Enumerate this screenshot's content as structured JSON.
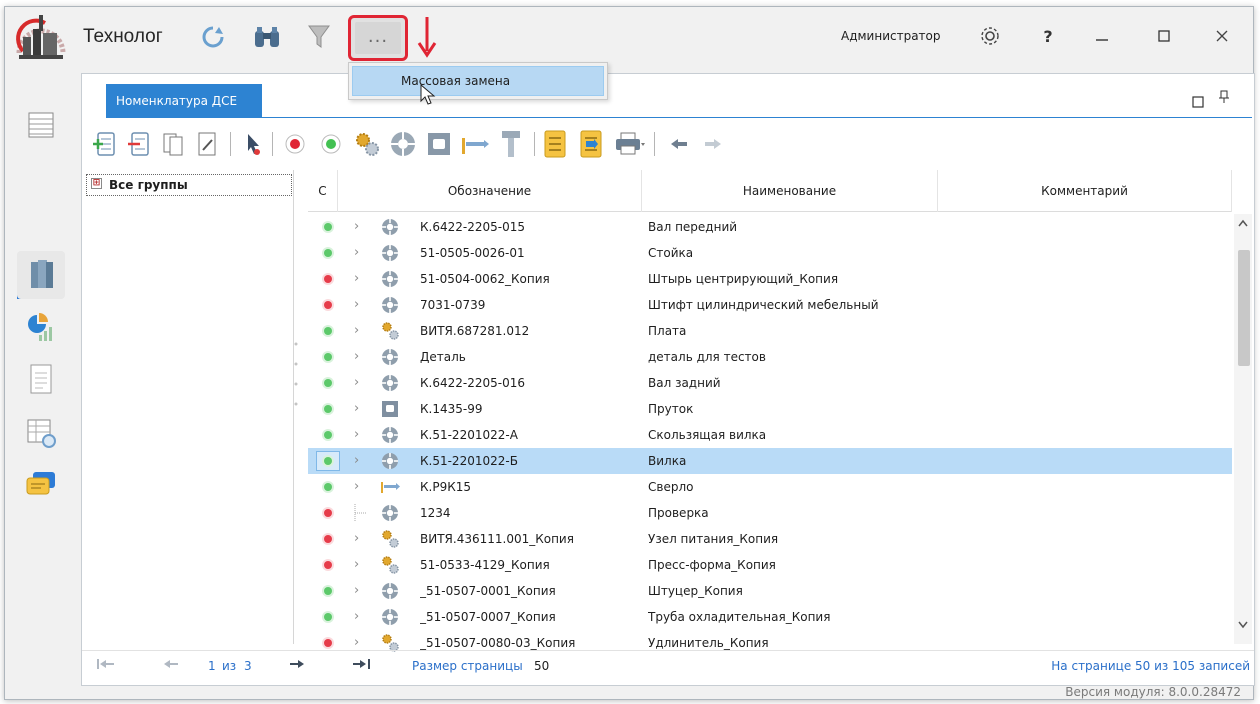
{
  "window": {
    "title": "Технолог",
    "user": "Администратор",
    "more_label": "...",
    "help_label": "?",
    "version": "Версия модуля: 8.0.0.28472"
  },
  "menu": {
    "items": [
      {
        "label": "Массовая замена"
      }
    ]
  },
  "tab": {
    "label": "Номенклатура ДСЕ"
  },
  "tree": {
    "root_label": "Все группы",
    "expander": "⊞"
  },
  "grid": {
    "columns": {
      "status": "С",
      "designation": "Обозначение",
      "name": "Наименование",
      "comment": "Комментарий"
    },
    "rows": [
      {
        "status": "green",
        "type": "part",
        "designation": "К.6422-2205-015",
        "name": "Вал передний",
        "comment": ""
      },
      {
        "status": "green",
        "type": "part",
        "designation": "51-0505-0026-01",
        "name": "Стойка",
        "comment": ""
      },
      {
        "status": "red",
        "type": "part",
        "designation": "51-0504-0062_Копия",
        "name": "Штырь центрирующий_Копия",
        "comment": ""
      },
      {
        "status": "red",
        "type": "part",
        "designation": "7031-0739",
        "name": "Штифт цилиндрический мебельный",
        "comment": ""
      },
      {
        "status": "green",
        "type": "assembly",
        "designation": "ВИТЯ.687281.012",
        "name": "Плата",
        "comment": ""
      },
      {
        "status": "green",
        "type": "part",
        "designation": "Деталь",
        "name": "деталь для тестов",
        "comment": ""
      },
      {
        "status": "green",
        "type": "part",
        "designation": "К.6422-2205-016",
        "name": "Вал задний",
        "comment": ""
      },
      {
        "status": "green",
        "type": "material",
        "designation": "К.1435-99",
        "name": "Пруток",
        "comment": ""
      },
      {
        "status": "green",
        "type": "part",
        "designation": "К.51-2201022-А",
        "name": "Скользящая вилка",
        "comment": ""
      },
      {
        "status": "green",
        "type": "part",
        "designation": "К.51-2201022-Б",
        "name": "Вилка",
        "comment": "",
        "selected": true
      },
      {
        "status": "green",
        "type": "tool",
        "designation": "К.Р9К15",
        "name": "Сверло",
        "comment": ""
      },
      {
        "status": "red",
        "type": "part",
        "designation": "1234",
        "name": "Проверка",
        "comment": "",
        "leaf": true
      },
      {
        "status": "red",
        "type": "assembly",
        "designation": "ВИТЯ.436111.001_Копия",
        "name": "Узел питания_Копия",
        "comment": ""
      },
      {
        "status": "red",
        "type": "assembly",
        "designation": "51-0533-4129_Копия",
        "name": "Пресс-форма_Копия",
        "comment": ""
      },
      {
        "status": "green",
        "type": "part",
        "designation": "_51-0507-0001_Копия",
        "name": "Штуцер_Копия",
        "comment": ""
      },
      {
        "status": "green",
        "type": "part",
        "designation": "_51-0507-0007_Копия",
        "name": "Труба охладительная_Копия",
        "comment": ""
      },
      {
        "status": "red",
        "type": "assembly",
        "designation": "_51-0507-0080-03_Копия",
        "name": "Удлинитель_Копия",
        "comment": ""
      }
    ]
  },
  "pager": {
    "current": "1",
    "of_word": "из",
    "total": "3",
    "page_size_label": "Размер страницы",
    "page_size": "50",
    "summary": "На странице 50 из 105 записей"
  },
  "colors": {
    "accent": "#2d83d2",
    "selection": "#b9dbf7",
    "highlight": "#e02534"
  }
}
